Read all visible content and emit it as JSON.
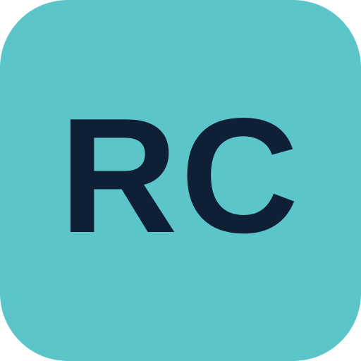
{
  "icon": {
    "monogram": "RC",
    "background_color": "#5bc5c9",
    "text_color": "#0f1f36"
  }
}
